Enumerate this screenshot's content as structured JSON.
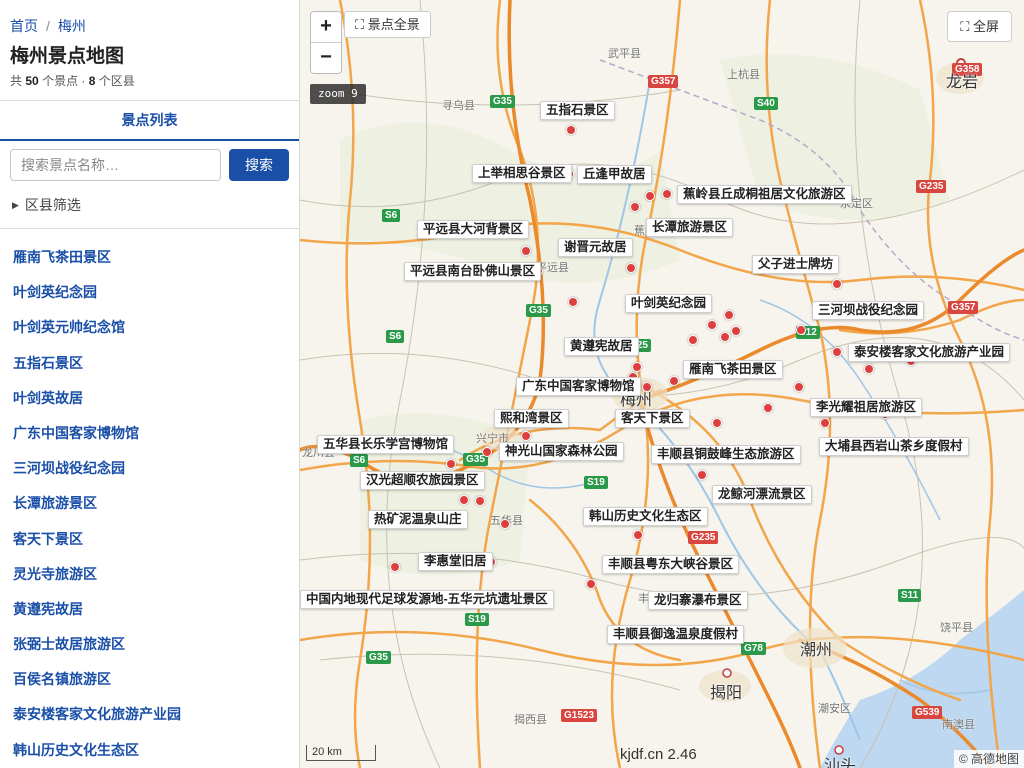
{
  "breadcrumb": {
    "home": "首页",
    "separator": "/",
    "current": "梅州"
  },
  "title": "梅州景点地图",
  "summary": {
    "prefix": "共",
    "spots_count": "50",
    "spots_unit": "个景点 ·",
    "districts_count": "8",
    "districts_unit": "个区县"
  },
  "tab": {
    "label": "景点列表"
  },
  "search": {
    "placeholder": "搜索景点名称…",
    "button_label": "搜索"
  },
  "filter": {
    "label": "区县筛选"
  },
  "spot_list": [
    "雁南飞茶田景区",
    "叶剑英纪念园",
    "叶剑英元帅纪念馆",
    "五指石景区",
    "叶剑英故居",
    "广东中国客家博物馆",
    "三河坝战役纪念园",
    "长潭旅游景区",
    "客天下景区",
    "灵光寺旅游区",
    "黄遵宪故居",
    "张弼士故居旅游区",
    "百侯名镇旅游区",
    "泰安楼客家文化旅游产业园",
    "韩山历史文化生态区"
  ],
  "map": {
    "zoom_in_label": "+",
    "zoom_out_label": "−",
    "overview_icon": "fit-bounds-icon",
    "overview_label": "⛶ 景点全景",
    "fullscreen_icon": "fullscreen-icon",
    "fullscreen_label": "⛶ 全屏",
    "zoom_badge": "zoom 9",
    "scale_label": "20 km",
    "credit_center": "kjdf.cn 2.46",
    "credit_right": "© 高德地图",
    "poi_labels": [
      "五指石景区",
      "上举相思谷景区",
      "丘逢甲故居",
      "蕉岭县丘成桐祖居文化旅游区",
      "平远县大河背景区",
      "长潭旅游景区",
      "谢晋元故居",
      "平远县南台卧佛山景区",
      "父子进士牌坊",
      "叶剑英纪念园",
      "三河坝战役纪念园",
      "黄遵宪故居",
      "泰安楼客家文化旅游产业园",
      "广东中国客家博物馆",
      "雁南飞茶田景区",
      "熙和湾景区",
      "客天下景区",
      "李光耀祖居旅游区",
      "五华县长乐学宫博物馆",
      "神光山国家森林公园",
      "丰顺县铜鼓峰生态旅游区",
      "大埔县西岩山茶乡度假村",
      "汉光超顺农旅园景区",
      "龙鲸河漂流景区",
      "热矿泥温泉山庄",
      "韩山历史文化生态区",
      "李惠堂旧居",
      "丰顺县粤东大峡谷景区",
      "中国内地现代足球发源地-五华元坑遗址景区",
      "龙归寨瀑布景区",
      "丰顺县御逸温泉度假村"
    ],
    "city_labels": [
      "龙岩",
      "梅州",
      "潮州",
      "揭阳",
      "汕头"
    ],
    "town_labels": [
      "武平县",
      "上杭县",
      "寻乌县",
      "永定区",
      "平远县",
      "兴宁市",
      "五华县",
      "揭西县",
      "潮安区",
      "饶平县",
      "南澳县",
      "龙川县",
      "蕉岭",
      "丰顺"
    ],
    "road_shields": {
      "national": [
        "G357",
        "G235",
        "G358",
        "G357",
        "G235",
        "G1523",
        "G539"
      ],
      "provincial": [
        "G35",
        "S40",
        "S6",
        "G35",
        "S6",
        "S12",
        "G25",
        "G35",
        "S6",
        "S19",
        "S19",
        "G35",
        "G78",
        "S11"
      ]
    }
  }
}
